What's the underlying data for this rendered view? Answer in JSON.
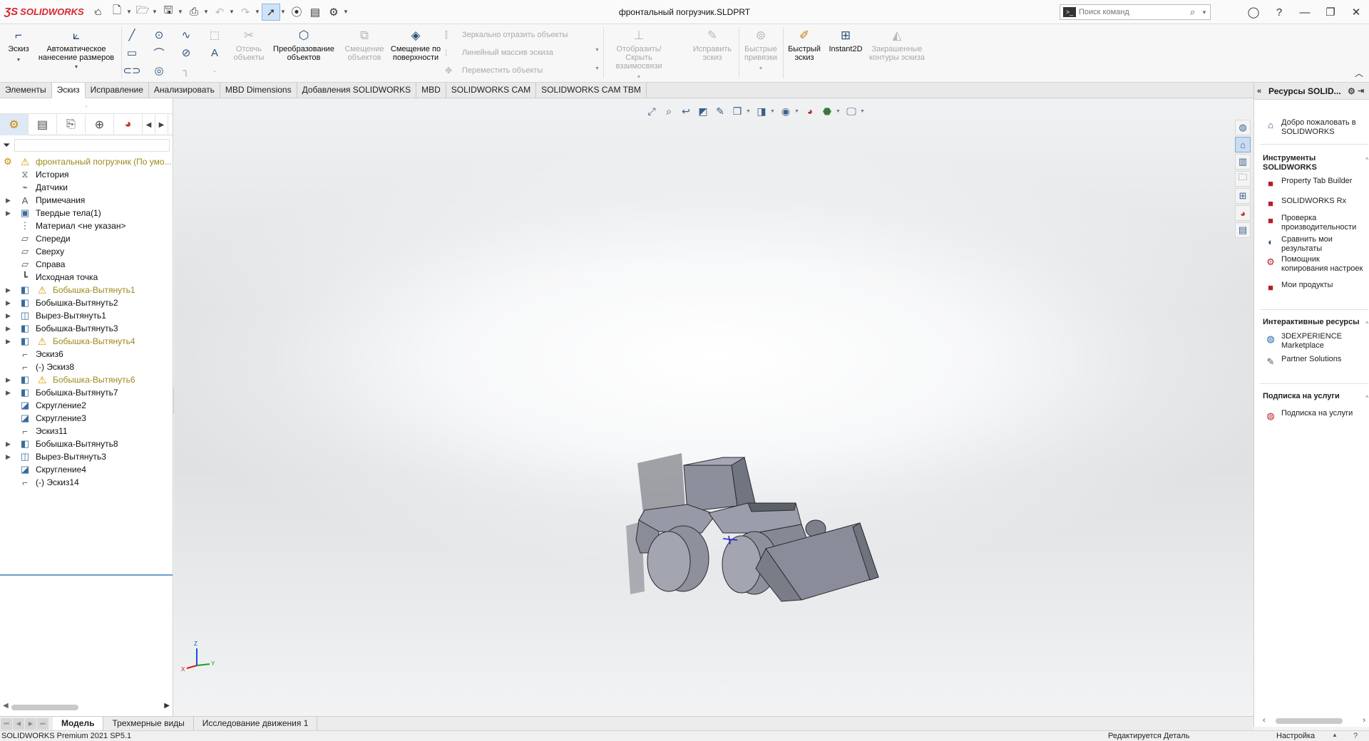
{
  "app": {
    "logo_text": "SOLIDWORKS",
    "logo_mark": "ƷS"
  },
  "document": {
    "title": "фронтальный погрузчик.SLDPRT"
  },
  "command_search": {
    "placeholder": "Поиск команд"
  },
  "ribbon": {
    "sketch": "Эскиз",
    "smart_dimension": "Автоматическое нанесение размеров",
    "trim": "Отсечь объекты",
    "convert": "Преобразование объектов",
    "offset": "Смещение объектов",
    "offset_surface": "Смещение по поверхности",
    "mirror": "Зеркально отразить объекты",
    "linear_pattern": "Линейный массив эскиза",
    "move": "Переместить объекты",
    "display_relations": "Отобразить/Скрыть взаимосвязи",
    "repair_sketch": "Исправить эскиз",
    "quick_snaps": "Быстрые привязки",
    "rapid_sketch": "Быстрый эскиз",
    "instant2d": "Instant2D",
    "shaded_contours": "Закрашенные контуры эскиза"
  },
  "tabs": [
    {
      "label": "Элементы"
    },
    {
      "label": "Эскиз"
    },
    {
      "label": "Исправление"
    },
    {
      "label": "Анализировать"
    },
    {
      "label": "MBD Dimensions"
    },
    {
      "label": "Добавления SOLIDWORKS"
    },
    {
      "label": "MBD"
    },
    {
      "label": "SOLIDWORKS CAM"
    },
    {
      "label": "SOLIDWORKS CAM TBM"
    }
  ],
  "feature_tree": {
    "root": "фронтальный погрузчик  (По умо...",
    "items": [
      {
        "label": "История"
      },
      {
        "label": "Датчики"
      },
      {
        "label": "Примечания"
      },
      {
        "label": "Твердые тела(1)"
      },
      {
        "label": "Материал <не указан>"
      },
      {
        "label": "Спереди"
      },
      {
        "label": "Сверху"
      },
      {
        "label": "Справа"
      },
      {
        "label": "Исходная точка"
      },
      {
        "label": "Бобышка-Вытянуть1"
      },
      {
        "label": "Бобышка-Вытянуть2"
      },
      {
        "label": "Вырез-Вытянуть1"
      },
      {
        "label": "Бобышка-Вытянуть3"
      },
      {
        "label": "Бобышка-Вытянуть4"
      },
      {
        "label": "Эскиз6"
      },
      {
        "label": "(-) Эскиз8"
      },
      {
        "label": "Бобышка-Вытянуть6"
      },
      {
        "label": "Бобышка-Вытянуть7"
      },
      {
        "label": "Скругление2"
      },
      {
        "label": "Скругление3"
      },
      {
        "label": "Эскиз11"
      },
      {
        "label": "Бобышка-Вытянуть8"
      },
      {
        "label": "Вырез-Вытянуть3"
      },
      {
        "label": "Скругление4"
      },
      {
        "label": "(-) Эскиз14"
      }
    ]
  },
  "task_pane": {
    "title": "Ресурсы SOLID...",
    "welcome": "Добро пожаловать в SOLIDWORKS",
    "tools_header": "Инструменты SOLIDWORKS",
    "tools": [
      {
        "label": "Property Tab Builder"
      },
      {
        "label": "SOLIDWORKS Rx"
      },
      {
        "label": "Проверка производительности"
      },
      {
        "label": "Сравнить мои результаты"
      },
      {
        "label": "Помощник копирования настроек"
      },
      {
        "label": "Мои продукты"
      }
    ],
    "online_header": "Интерактивные ресурсы",
    "online": [
      {
        "label": "3DEXPERIENCE Marketplace"
      },
      {
        "label": "Partner Solutions"
      }
    ],
    "subscription_header": "Подписка на услуги",
    "subscription": [
      {
        "label": "Подписка на услуги"
      }
    ]
  },
  "bottom_tabs": [
    {
      "label": "Модель"
    },
    {
      "label": "Трехмерные виды"
    },
    {
      "label": "Исследование движения 1"
    }
  ],
  "status": {
    "version": "SOLIDWORKS Premium 2021 SP5.1",
    "editing": "Редактируется Деталь",
    "custom": "Настройка"
  },
  "triad": {
    "z": "Z",
    "x": "X",
    "y": "Y"
  }
}
